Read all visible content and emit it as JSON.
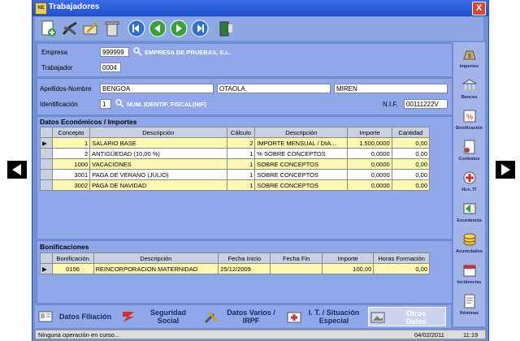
{
  "window": {
    "title": "Trabajadores",
    "close_label": "X",
    "app_icon_label": "NE"
  },
  "empresa": {
    "label": "Empresa",
    "value": "999999",
    "name": "EMPRESA DE PRUEBAS, S.L."
  },
  "trabajador": {
    "label": "Trabajador",
    "value": "0004"
  },
  "persona": {
    "label": "Apellidos-Nombre",
    "apellido1": "BENGOA",
    "apellido2": "OTAOLA",
    "nombre": "MIREN",
    "id_label": "Identificación",
    "id_value": "1",
    "id_desc": "NUM. IDENTIF. FISCAL(NIF)",
    "nif_label": "N.I.F.",
    "nif_value": "00111222V"
  },
  "datos": {
    "title": "Datos Económicos / Importes",
    "headers": [
      "Concepto",
      "Descripción",
      "Cálculo",
      "Descripción",
      "Importe",
      "Cantidad"
    ],
    "rows": [
      {
        "concepto": "1",
        "descripcion": "SALARIO BASE",
        "calculo": "2",
        "desc_calc": "IMPORTE MENSUAL / DIA...",
        "importe": "1.500,0000",
        "cantidad": "0,00"
      },
      {
        "concepto": "2",
        "descripcion": "ANTIGÜEDAD (10,00 %)",
        "calculo": "1",
        "desc_calc": "% SOBRE CONCEPTOS",
        "importe": "0,0000",
        "cantidad": "0,00"
      },
      {
        "concepto": "1000",
        "descripcion": "VACACIONES",
        "calculo": "1",
        "desc_calc": "SOBRE CONCEPTOS",
        "importe": "0,0000",
        "cantidad": "0,00"
      },
      {
        "concepto": "3001",
        "descripcion": "PAGA DE VERANO (JULIO)",
        "calculo": "1",
        "desc_calc": "SOBRE CONCEPTOS",
        "importe": "0,0000",
        "cantidad": "0,00"
      },
      {
        "concepto": "3002",
        "descripcion": "PAGA DE NAVIDAD",
        "calculo": "1",
        "desc_calc": "SOBRE CONCEPTOS",
        "importe": "0,0000",
        "cantidad": "0,00"
      }
    ]
  },
  "bonificaciones": {
    "title": "Bonificaciones",
    "headers": [
      "Bonificación",
      "Descripción",
      "Fecha Inicio",
      "Fecha Fin",
      "Importe",
      "Horas Formación"
    ],
    "rows": [
      {
        "bonificacion": "0156",
        "descripcion": "REINCORPORACION MATERNIDAD",
        "inicio": "25/12/2009",
        "fin": "",
        "importe": "100,00",
        "horas": "0,00"
      }
    ]
  },
  "sidebar": {
    "items": [
      {
        "label": "Importes",
        "icon": "money-bag-icon"
      },
      {
        "label": "Bancos",
        "icon": "bank-icon"
      },
      {
        "label": "Bonificación",
        "icon": "discount-icon"
      },
      {
        "label": "Contratos",
        "icon": "contract-icon"
      },
      {
        "label": "Hco. IT",
        "icon": "medical-icon"
      },
      {
        "label": "Excedencia",
        "icon": "exit-icon"
      },
      {
        "label": "Acumulados",
        "icon": "coins-icon"
      },
      {
        "label": "Incidencias",
        "icon": "calendar-icon"
      },
      {
        "label": "Nóminas",
        "icon": "payroll-icon"
      }
    ]
  },
  "bottom_tabs": [
    {
      "line1": "Datos Filiación",
      "line2": ""
    },
    {
      "line1": "Seguridad",
      "line2": "Social"
    },
    {
      "line1": "Datos Varios /",
      "line2": "IRPF"
    },
    {
      "line1": "I. T. / Situación",
      "line2": "Especial"
    },
    {
      "line1": "Otros",
      "line2": "Datos"
    }
  ],
  "status": {
    "message": "Ninguna operación en curso...",
    "date": "04/02/2011",
    "time": "11:19"
  },
  "colors": {
    "window": "#6f8fd8",
    "titlebar": "#1f4fd0",
    "row_highlight": "#fff8b0"
  }
}
